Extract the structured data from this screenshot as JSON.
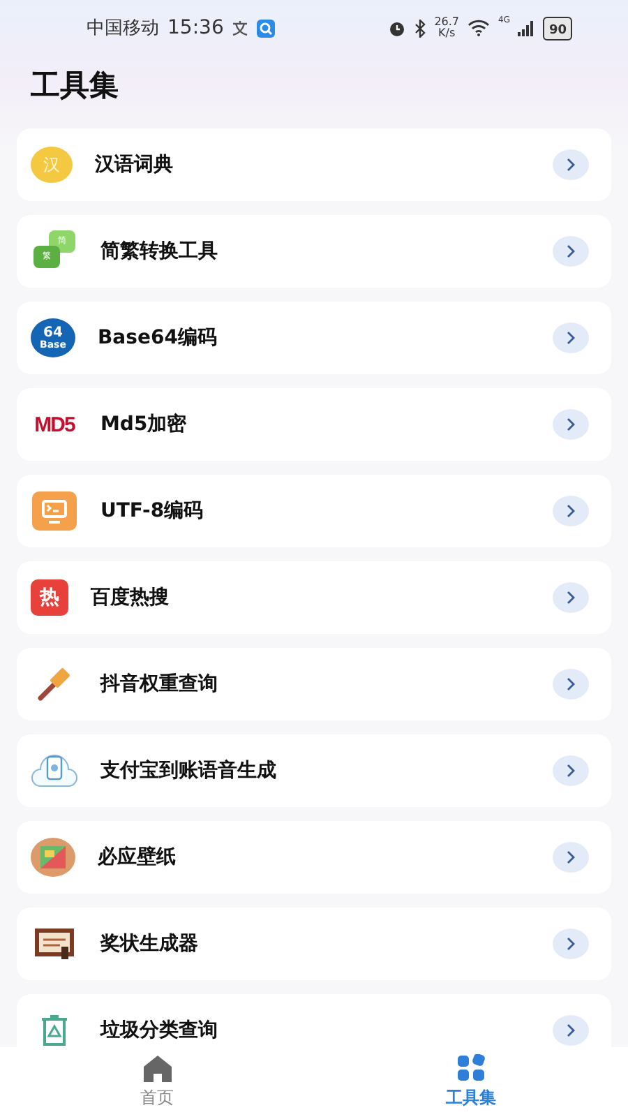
{
  "status_bar": {
    "carrier": "中国移动",
    "time": "15:36",
    "speed_value": "26.7",
    "speed_unit": "K/s",
    "network": "4G",
    "battery": "90"
  },
  "title": "工具集",
  "tools": [
    {
      "kind": "dict",
      "label": "汉语词典",
      "icon_text": [
        "汉"
      ]
    },
    {
      "kind": "convert",
      "label": "简繁转换工具",
      "icon_text": [
        "简",
        "繁"
      ]
    },
    {
      "kind": "base64",
      "label": "Base64编码",
      "icon_text": [
        "64",
        "Base"
      ]
    },
    {
      "kind": "md5",
      "label": "Md5加密",
      "icon_text": [
        "MD5"
      ]
    },
    {
      "kind": "monitor",
      "label": "UTF-8编码"
    },
    {
      "kind": "hot",
      "label": "百度热搜",
      "icon_text": [
        "热"
      ]
    },
    {
      "kind": "hammer",
      "label": "抖音权重查询"
    },
    {
      "kind": "voice",
      "label": "支付宝到账语音生成"
    },
    {
      "kind": "wallpaper",
      "label": "必应壁纸"
    },
    {
      "kind": "certificate",
      "label": "奖状生成器"
    },
    {
      "kind": "trash",
      "label": "垃圾分类查询"
    }
  ],
  "tab_bar": [
    {
      "kind": "home",
      "label": "首页",
      "selected": false
    },
    {
      "kind": "tools",
      "label": "工具集",
      "selected": true
    }
  ]
}
